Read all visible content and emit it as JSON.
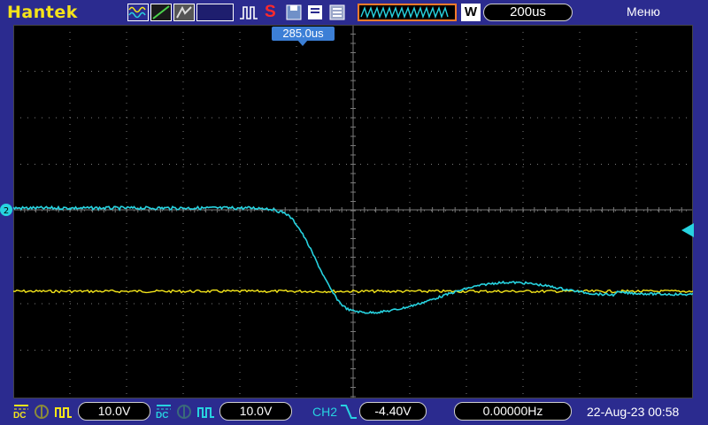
{
  "brand": "Hantek",
  "top": {
    "record_indicator": "S",
    "mode_label": "W",
    "timebase": "200us",
    "menu": "Меню",
    "trigger_offset": "285.0us"
  },
  "colors": {
    "ch1": "#f5e61a",
    "ch2": "#27d3e0",
    "background": "#2b2b8f",
    "screen": "#000000",
    "grid": "#7a7a7a"
  },
  "ch1": {
    "coupling": "DC",
    "volts_per_div": "10.0V"
  },
  "ch2": {
    "coupling": "DC",
    "volts_per_div": "10.0V"
  },
  "trigger": {
    "source": "CH2",
    "level": "-4.40V",
    "frequency": "0.00000Hz"
  },
  "datetime": "22-Aug-23 00:58",
  "icons": [
    "waveform-icon",
    "cursor-icon",
    "persistence-icon",
    "run-stop-icon",
    "record-icon",
    "save-icon",
    "print-icon",
    "memory-depth-icon",
    "ch1-ground-icon",
    "ch1-probe-icon",
    "ch2-ground-icon",
    "ch2-probe-icon",
    "trigger-edge-falling-icon"
  ]
}
